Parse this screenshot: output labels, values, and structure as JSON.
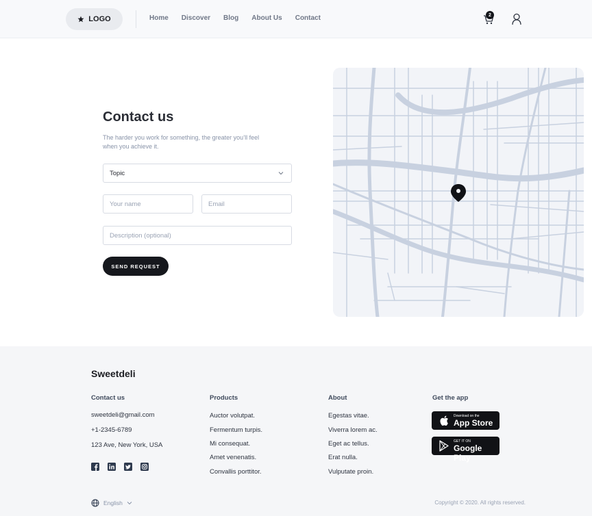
{
  "header": {
    "logo_label": "LOGO",
    "nav": [
      "Home",
      "Discover",
      "Blog",
      "About Us",
      "Contact"
    ],
    "cart_count": "2"
  },
  "contact": {
    "title": "Contact us",
    "subtitle": "The harder you work for something, the greater you’ll feel when you achieve it.",
    "topic_value": "Topic",
    "name_placeholder": "Your name",
    "email_placeholder": "Email",
    "description_placeholder": "Description (optional)",
    "send_label": "SEND REQUEST"
  },
  "footer": {
    "brand": "Sweetdeli",
    "contact_title": "Contact us",
    "contact_items": [
      "sweetdeli@gmail.com",
      "+1-2345-6789",
      "123 Ave, New York, USA"
    ],
    "products_title": "Products",
    "products_items": [
      "Auctor volutpat.",
      "Fermentum turpis.",
      "Mi consequat.",
      "Amet venenatis.",
      "Convallis porttitor."
    ],
    "about_title": "About",
    "about_items": [
      "Egestas vitae.",
      "Viverra lorem ac.",
      "Eget ac tellus.",
      "Erat nulla.",
      "Vulputate proin."
    ],
    "app_title": "Get the app",
    "app_store_small": "Download on the",
    "app_store_big": "App Store",
    "google_small": "GET IT ON",
    "google_big": "Google Play",
    "language": "English",
    "copyright": "Copyright © 2020. All rights reserved.",
    "social_icons": [
      "facebook-icon",
      "linkedin-icon",
      "twitter-icon",
      "instagram-icon"
    ]
  },
  "colors": {
    "accent_dark": "#16181d",
    "map_street": "#c8d1e0",
    "map_bg": "#f2f4f8"
  }
}
